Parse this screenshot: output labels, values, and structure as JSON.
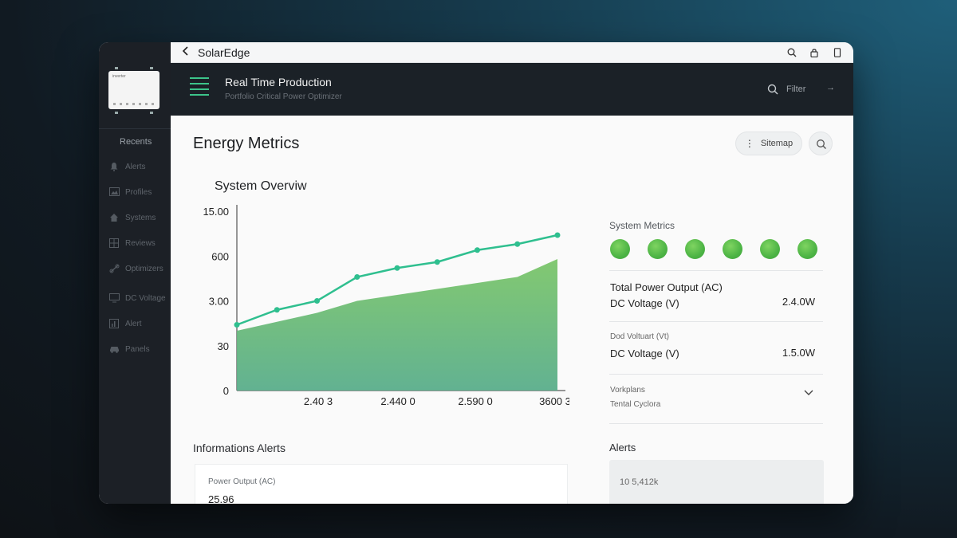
{
  "topbar": {
    "title": "SolarEdge",
    "icons": [
      "chevron-left-icon",
      "search-icon",
      "lock-icon",
      "tablet-icon"
    ]
  },
  "header": {
    "title": "Real Time Production",
    "subtitle": "Portfolio Critical Power Optimizer",
    "search_label": "Filter",
    "arrow": "→"
  },
  "sidebar": {
    "device_label": "inverter",
    "section_heading": "Recents",
    "items": [
      {
        "label": "Alerts",
        "icon": "bell-icon"
      },
      {
        "label": "Profiles",
        "icon": "image-icon"
      },
      {
        "label": "Systems",
        "icon": "home-icon"
      },
      {
        "label": "Reviews",
        "icon": "grid-icon"
      },
      {
        "label": "Optimizers",
        "icon": "link-icon"
      },
      {
        "label": "DC Voltage",
        "icon": "monitor-icon"
      },
      {
        "label": "Alert",
        "icon": "chart-icon"
      },
      {
        "label": "Panels",
        "icon": "car-icon"
      }
    ]
  },
  "main": {
    "page_title": "Energy Metrics",
    "sitemap_label": "Sitemap",
    "chart_title": "System Overviw",
    "metrics_title": "System Metrics",
    "metrics": [
      {
        "label": "Total Power Output (AC)",
        "sublabel": "DC Voltage (V)",
        "value": "2.4.0W"
      },
      {
        "label": "Dod Voltuart (Vt)",
        "sublabel": "DC Voltage (V)",
        "value": "1.5.0W"
      },
      {
        "label": "Vorkplans",
        "sublabel": "Tental Cyclora",
        "value": ""
      }
    ],
    "info_title": "Informations Alerts",
    "info_card": {
      "label": "Power Output (AC)",
      "value": "25.96"
    },
    "alerts_title": "Alerts",
    "alerts_text": "10 5,412k"
  },
  "colors": {
    "accent_green": "#3cc48a",
    "line": "#2fbf8f",
    "area_top": "#7cc66a",
    "area_bottom": "#5aae8c",
    "status_green": "#4db445"
  },
  "chart_data": {
    "type": "area",
    "title": "System Overviw",
    "x_tick_labels": [
      "2.40 3",
      "2.440 0",
      "2.590 0",
      "3600 3"
    ],
    "y_tick_labels": [
      "15.00",
      "600",
      "3.00",
      "30",
      "0"
    ],
    "series": [
      {
        "values": [
          22,
          27,
          30,
          38,
          41,
          43,
          47,
          49,
          52
        ]
      },
      {
        "values": [
          20,
          23,
          26,
          30,
          32,
          34,
          36,
          38,
          44
        ]
      }
    ],
    "ylim": [
      0,
      60
    ],
    "grid": false
  }
}
